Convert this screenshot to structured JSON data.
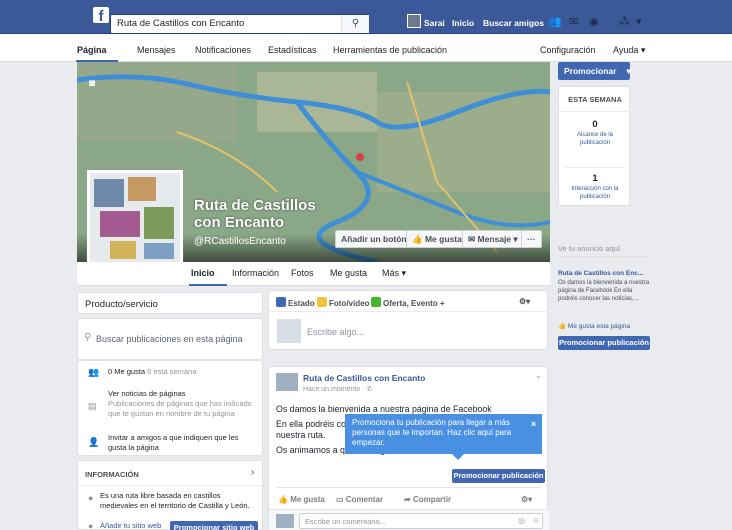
{
  "topbar": {
    "logo": "f",
    "search_value": "Ruta de Castillos con Encanto",
    "user_name": "Sarai",
    "home_label": "Inicio",
    "find_friends_label": "Buscar amigos"
  },
  "pagenav": {
    "items": [
      "Página",
      "Mensajes",
      "Notificaciones",
      "Estadísticas",
      "Herramientas de publicación"
    ],
    "settings_label": "Configuración",
    "help_label": "Ayuda ▾"
  },
  "cover": {
    "page_name": "Ruta de Castillos con Encanto",
    "handle": "@RCastillosEncanto",
    "add_button_label": "Añadir un botón",
    "like_label": "Me gusta",
    "message_label": "Mensaje ▾",
    "more_label": "···"
  },
  "tabs": [
    "Inicio",
    "Información",
    "Fotos",
    "Me gusta",
    "Más ▾"
  ],
  "left": {
    "category": "Producto/servicio",
    "search_placeholder": "Buscar publicaciones en esta página",
    "likes_text": "0 Me gusta",
    "likes_sub": "0 esta semana",
    "notif_title": "Ver noticias de páginas",
    "notif_text": "Publicaciones de páginas que has indicado que te gustan en nombre de tu página",
    "invite_text": "Invitar a amigos a que indiquen que les gusta la página",
    "info_title": "INFORMACIÓN",
    "info_text": "Es una ruta libre basada en castillos medievales en el territorio de Castilla y León.",
    "add_site_label": "Añadir tu sitio web",
    "promote_site_label": "Promocionar sitio web"
  },
  "composer": {
    "estado_label": "Estado",
    "foto_label": "Foto/vídeo",
    "oferta_label": "Oferta, Evento +",
    "placeholder": "Escribe algo..."
  },
  "post": {
    "author": "Ruta de Castillos con Encanto",
    "time": "Hace un momento · ✆",
    "line1": "Os damos la bienvenida a nuestra página de Facebook",
    "line2": "En ella podréis conocer las",
    "line3": "nuestra ruta.",
    "line4": "Os animamos a que nos sig",
    "promote_label": "Promocionar publicación",
    "like_label": "Me gusta",
    "comment_label": "Comentar",
    "share_label": "Compartir",
    "comment_placeholder": "Escribe un comentario..."
  },
  "tooltip": {
    "text": "Promociona tu publicación para llegar a más personas que te importan. Haz clic aquí para empezar.",
    "close": "×"
  },
  "right": {
    "promote_label": "Promocionar",
    "week_title": "ESTA SEMANA",
    "reach_value": "0",
    "reach_label": "Alcance de la publicación",
    "interaction_value": "1",
    "interaction_label": "Interacción con la publicación",
    "ad_header": "Ve tu anuncio aquí",
    "ad_title": "Ruta de Castillos con Enc...",
    "ad_body": "Os damos la bienvenida a nuestra página de Facebook En ella podréis conocer las noticias,...",
    "ad_like": "Me gusta esta página",
    "ad_promote": "Promocionar publicación"
  },
  "colors": {
    "brand": "#3b5998",
    "accent": "#4267b2",
    "tooltip": "#4a90e2"
  }
}
